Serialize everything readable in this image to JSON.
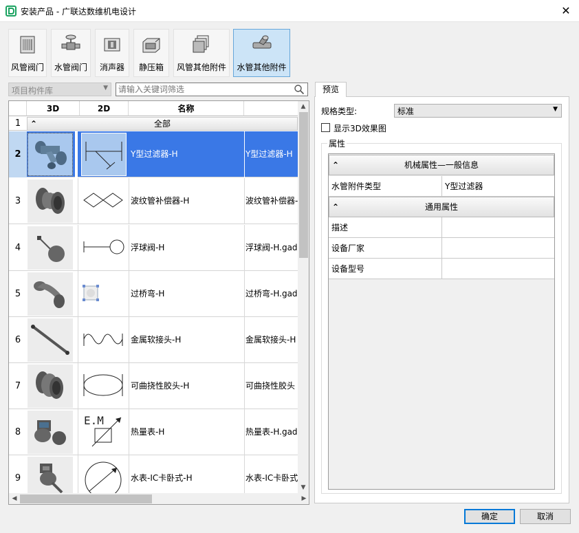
{
  "window": {
    "title": "安装产品 - 广联达数维机电设计",
    "close_glyph": "✕"
  },
  "categories": [
    {
      "label": "风管阀门",
      "icon": "duct-valve-icon"
    },
    {
      "label": "水管阀门",
      "icon": "water-valve-icon"
    },
    {
      "label": "消声器",
      "icon": "silencer-icon"
    },
    {
      "label": "静压箱",
      "icon": "plenum-box-icon"
    },
    {
      "label": "风管其他附件",
      "icon": "duct-accessory-icon"
    },
    {
      "label": "水管其他附件",
      "icon": "pipe-accessory-icon",
      "active": true
    }
  ],
  "library": {
    "selected": "项目构件库"
  },
  "search": {
    "placeholder": "请输入关键词筛选"
  },
  "grid": {
    "headers": [
      "3D",
      "2D",
      "名称"
    ],
    "group_row_num": "1",
    "group_label": "全部",
    "rows": [
      {
        "num": "2",
        "name": "Y型过滤器-H",
        "file": "Y型过滤器-H",
        "selected": true
      },
      {
        "num": "3",
        "name": "波纹管补偿器-H",
        "file": "波纹管补偿器-"
      },
      {
        "num": "4",
        "name": "浮球阀-H",
        "file": "浮球阀-H.gad"
      },
      {
        "num": "5",
        "name": "过桥弯-H",
        "file": "过桥弯-H.gad"
      },
      {
        "num": "6",
        "name": "金属软接头-H",
        "file": "金属软接头-H"
      },
      {
        "num": "7",
        "name": "可曲挠性胶头-H",
        "file": "可曲挠性胶头"
      },
      {
        "num": "8",
        "name": "热量表-H",
        "file": "热量表-H.gad"
      },
      {
        "num": "9",
        "name": "水表-IC卡卧式-H",
        "file": "水表-IC卡卧式"
      }
    ]
  },
  "preview": {
    "tab_label": "预览",
    "spec_label": "规格类型:",
    "spec_value": "标准",
    "show3d_label": "显示3D效果图",
    "show3d_checked": false,
    "props_caption": "属性",
    "groups": [
      {
        "title": "机械属性—一般信息",
        "rows": [
          {
            "key": "水管附件类型",
            "value": "Y型过滤器"
          }
        ]
      },
      {
        "title": "通用属性",
        "rows": [
          {
            "key": "描述",
            "value": ""
          },
          {
            "key": "设备厂家",
            "value": ""
          },
          {
            "key": "设备型号",
            "value": ""
          }
        ]
      }
    ]
  },
  "buttons": {
    "ok": "确定",
    "cancel": "取消"
  },
  "colors": {
    "selection": "#3a78e6",
    "accent": "#0078d7",
    "active_tab_bg": "#cce4f7"
  }
}
